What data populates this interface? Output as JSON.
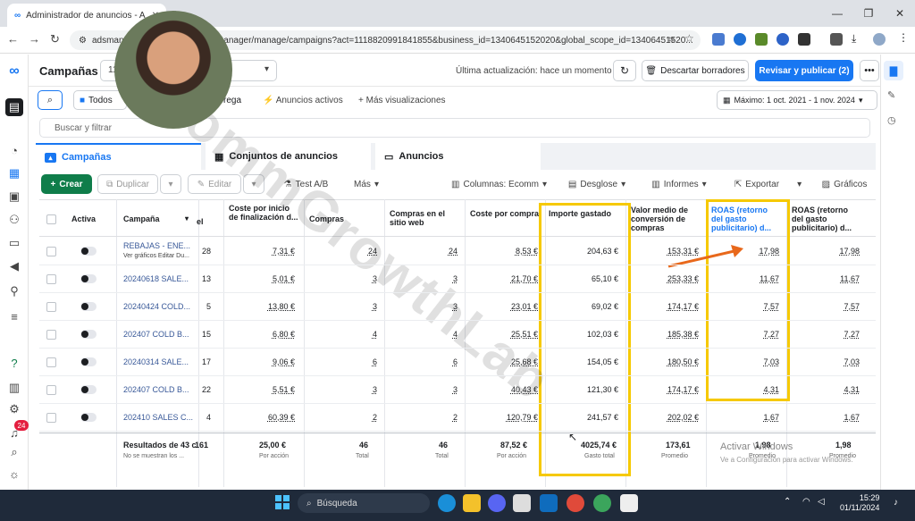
{
  "browser": {
    "tab_title": "Administrador de anuncios - A",
    "url": "adsmanager.facebook.com/adsmanager/manage/campaigns?act=1118820991841855&business_id=1340645152020&global_scope_id=13406451520..."
  },
  "header": {
    "title": "Campañas",
    "campaign_select": "11",
    "last_updated": "Última actualización: hace un momento",
    "discard_label": "Descartar borradores",
    "publish_label": "Revisar y publicar (2)"
  },
  "filters": {
    "todos_label": "Todos",
    "entrega_label": "rega",
    "activos_label": "Anuncios activos",
    "mas_label": "Más visualizaciones",
    "date_range": "Máximo: 1 oct. 2021 - 1 nov. 2024",
    "search_placeholder": "Buscar y filtrar"
  },
  "levels": {
    "campaigns": "Campañas",
    "adsets": "Conjuntos de anuncios",
    "ads": "Anuncios"
  },
  "toolbar": {
    "create": "Crear",
    "duplicate": "Duplicar",
    "edit": "Editar",
    "abtest": "Test A/B",
    "more": "Más",
    "columns": "Columnas: Ecomm",
    "breakdown": "Desglose",
    "reports": "Informes",
    "export": "Exportar",
    "charts": "Gráficos"
  },
  "table": {
    "headers": {
      "active": "Activa",
      "campaign": "Campaña",
      "col_el": "el",
      "cost_checkout": "Coste por inicio de finalización d...",
      "purchases": "Compras",
      "web_purchases": "Compras en el sitio web",
      "cost_purchase": "Coste por compra",
      "amount_spent": "Importe gastado",
      "avg_value": "Valor medio de conversión de compras",
      "roas": "ROAS (retorno del gasto publicitario) d...",
      "roas2": "ROAS (retorno del gasto publicitario) d..."
    },
    "rows": [
      {
        "name": "REBAJAS - ENE...",
        "el": "28",
        "cost_checkout": "7,31 €",
        "purchases": "24",
        "web_purchases": "24",
        "cost_purchase": "8,53 €",
        "spent": "204,63 €",
        "avg_value": "153,31 €",
        "roas": "17,98",
        "roas2": "17,98"
      },
      {
        "name": "20240618 SALE...",
        "el": "13",
        "cost_checkout": "5,01 €",
        "purchases": "3",
        "web_purchases": "3",
        "cost_purchase": "21,70 €",
        "spent": "65,10 €",
        "avg_value": "253,33 €",
        "roas": "11,67",
        "roas2": "11,67"
      },
      {
        "name": "20240424 COLD...",
        "el": "5",
        "cost_checkout": "13,80 €",
        "purchases": "3",
        "web_purchases": "3",
        "cost_purchase": "23,01 €",
        "spent": "69,02 €",
        "avg_value": "174,17 €",
        "roas": "7,57",
        "roas2": "7,57"
      },
      {
        "name": "202407 COLD B...",
        "el": "15",
        "cost_checkout": "6,80 €",
        "purchases": "4",
        "web_purchases": "4",
        "cost_purchase": "25,51 €",
        "spent": "102,03 €",
        "avg_value": "185,38 €",
        "roas": "7,27",
        "roas2": "7,27"
      },
      {
        "name": "20240314 SALE...",
        "el": "17",
        "cost_checkout": "9,06 €",
        "purchases": "6",
        "web_purchases": "6",
        "cost_purchase": "25,68 €",
        "spent": "154,05 €",
        "avg_value": "180,50 €",
        "roas": "7,03",
        "roas2": "7,03"
      },
      {
        "name": "202407 COLD B...",
        "el": "22",
        "cost_checkout": "5,51 €",
        "purchases": "3",
        "web_purchases": "3",
        "cost_purchase": "40,43 €",
        "spent": "121,30 €",
        "avg_value": "174,17 €",
        "roas": "4,31",
        "roas2": "4,31"
      },
      {
        "name": "202410 SALES C...",
        "el": "4",
        "cost_checkout": "60,39 €",
        "purchases": "2",
        "web_purchases": "2",
        "cost_purchase": "120,79 €",
        "spent": "241,57 €",
        "avg_value": "202,02 €",
        "roas": "1,67",
        "roas2": "1,67"
      }
    ],
    "totals": {
      "label": "Resultados de 43 c",
      "sublabel": "No se muestran los ...",
      "el": "161",
      "cost_checkout": "25,00 €",
      "cost_checkout_sub": "Por acción",
      "purchases": "46",
      "purchases_sub": "Total",
      "web_purchases": "46",
      "web_sub": "Total",
      "cost_purchase": "87,52 €",
      "cost_purchase_sub": "Por acción",
      "spent": "4025,74 €",
      "spent_sub": "Gasto total",
      "avg_value": "173,61",
      "avg_sub": "Promedio",
      "roas": "1,98",
      "roas_sub": "Promedio",
      "roas2": "1,98",
      "roas2_sub": "Promedio"
    },
    "row_actions": "Ver gráficos   Editar   Du..."
  },
  "overlay": {
    "watermark": "CommGrowthLab",
    "windows_activate": "Activar Windows",
    "windows_activate_sub": "Ve a Configuración para activar Windows."
  },
  "taskbar": {
    "search": "Búsqueda",
    "time": "15:29",
    "date": "01/11/2024"
  },
  "colors": {
    "accent": "#1877f2",
    "create_green": "#0f7d4a",
    "highlight_yellow": "#f6c900",
    "arrow_orange": "#e8681b",
    "notif_badge": "24"
  }
}
